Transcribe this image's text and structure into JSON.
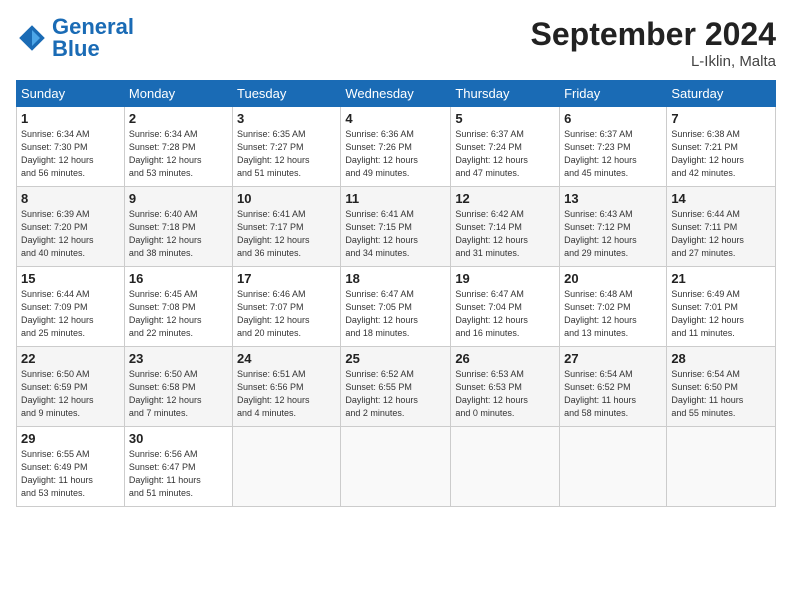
{
  "header": {
    "logo_general": "General",
    "logo_blue": "Blue",
    "month_title": "September 2024",
    "location": "L-Iklin, Malta"
  },
  "calendar": {
    "days_of_week": [
      "Sunday",
      "Monday",
      "Tuesday",
      "Wednesday",
      "Thursday",
      "Friday",
      "Saturday"
    ],
    "weeks": [
      [
        {
          "day": "",
          "info": ""
        },
        {
          "day": "2",
          "info": "Sunrise: 6:34 AM\nSunset: 7:28 PM\nDaylight: 12 hours\nand 53 minutes."
        },
        {
          "day": "3",
          "info": "Sunrise: 6:35 AM\nSunset: 7:27 PM\nDaylight: 12 hours\nand 51 minutes."
        },
        {
          "day": "4",
          "info": "Sunrise: 6:36 AM\nSunset: 7:26 PM\nDaylight: 12 hours\nand 49 minutes."
        },
        {
          "day": "5",
          "info": "Sunrise: 6:37 AM\nSunset: 7:24 PM\nDaylight: 12 hours\nand 47 minutes."
        },
        {
          "day": "6",
          "info": "Sunrise: 6:37 AM\nSunset: 7:23 PM\nDaylight: 12 hours\nand 45 minutes."
        },
        {
          "day": "7",
          "info": "Sunrise: 6:38 AM\nSunset: 7:21 PM\nDaylight: 12 hours\nand 42 minutes."
        }
      ],
      [
        {
          "day": "8",
          "info": "Sunrise: 6:39 AM\nSunset: 7:20 PM\nDaylight: 12 hours\nand 40 minutes."
        },
        {
          "day": "9",
          "info": "Sunrise: 6:40 AM\nSunset: 7:18 PM\nDaylight: 12 hours\nand 38 minutes."
        },
        {
          "day": "10",
          "info": "Sunrise: 6:41 AM\nSunset: 7:17 PM\nDaylight: 12 hours\nand 36 minutes."
        },
        {
          "day": "11",
          "info": "Sunrise: 6:41 AM\nSunset: 7:15 PM\nDaylight: 12 hours\nand 34 minutes."
        },
        {
          "day": "12",
          "info": "Sunrise: 6:42 AM\nSunset: 7:14 PM\nDaylight: 12 hours\nand 31 minutes."
        },
        {
          "day": "13",
          "info": "Sunrise: 6:43 AM\nSunset: 7:12 PM\nDaylight: 12 hours\nand 29 minutes."
        },
        {
          "day": "14",
          "info": "Sunrise: 6:44 AM\nSunset: 7:11 PM\nDaylight: 12 hours\nand 27 minutes."
        }
      ],
      [
        {
          "day": "15",
          "info": "Sunrise: 6:44 AM\nSunset: 7:09 PM\nDaylight: 12 hours\nand 25 minutes."
        },
        {
          "day": "16",
          "info": "Sunrise: 6:45 AM\nSunset: 7:08 PM\nDaylight: 12 hours\nand 22 minutes."
        },
        {
          "day": "17",
          "info": "Sunrise: 6:46 AM\nSunset: 7:07 PM\nDaylight: 12 hours\nand 20 minutes."
        },
        {
          "day": "18",
          "info": "Sunrise: 6:47 AM\nSunset: 7:05 PM\nDaylight: 12 hours\nand 18 minutes."
        },
        {
          "day": "19",
          "info": "Sunrise: 6:47 AM\nSunset: 7:04 PM\nDaylight: 12 hours\nand 16 minutes."
        },
        {
          "day": "20",
          "info": "Sunrise: 6:48 AM\nSunset: 7:02 PM\nDaylight: 12 hours\nand 13 minutes."
        },
        {
          "day": "21",
          "info": "Sunrise: 6:49 AM\nSunset: 7:01 PM\nDaylight: 12 hours\nand 11 minutes."
        }
      ],
      [
        {
          "day": "22",
          "info": "Sunrise: 6:50 AM\nSunset: 6:59 PM\nDaylight: 12 hours\nand 9 minutes."
        },
        {
          "day": "23",
          "info": "Sunrise: 6:50 AM\nSunset: 6:58 PM\nDaylight: 12 hours\nand 7 minutes."
        },
        {
          "day": "24",
          "info": "Sunrise: 6:51 AM\nSunset: 6:56 PM\nDaylight: 12 hours\nand 4 minutes."
        },
        {
          "day": "25",
          "info": "Sunrise: 6:52 AM\nSunset: 6:55 PM\nDaylight: 12 hours\nand 2 minutes."
        },
        {
          "day": "26",
          "info": "Sunrise: 6:53 AM\nSunset: 6:53 PM\nDaylight: 12 hours\nand 0 minutes."
        },
        {
          "day": "27",
          "info": "Sunrise: 6:54 AM\nSunset: 6:52 PM\nDaylight: 11 hours\nand 58 minutes."
        },
        {
          "day": "28",
          "info": "Sunrise: 6:54 AM\nSunset: 6:50 PM\nDaylight: 11 hours\nand 55 minutes."
        }
      ],
      [
        {
          "day": "29",
          "info": "Sunrise: 6:55 AM\nSunset: 6:49 PM\nDaylight: 11 hours\nand 53 minutes."
        },
        {
          "day": "30",
          "info": "Sunrise: 6:56 AM\nSunset: 6:47 PM\nDaylight: 11 hours\nand 51 minutes."
        },
        {
          "day": "",
          "info": ""
        },
        {
          "day": "",
          "info": ""
        },
        {
          "day": "",
          "info": ""
        },
        {
          "day": "",
          "info": ""
        },
        {
          "day": "",
          "info": ""
        }
      ]
    ],
    "week1_day1": {
      "day": "1",
      "info": "Sunrise: 6:34 AM\nSunset: 7:30 PM\nDaylight: 12 hours\nand 56 minutes."
    }
  }
}
